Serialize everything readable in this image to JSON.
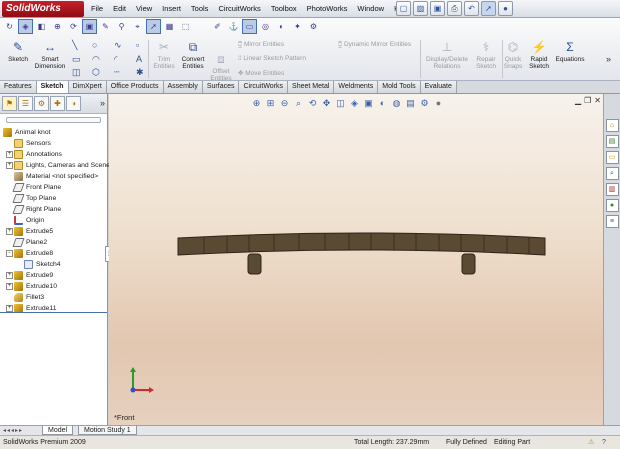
{
  "app": {
    "logo_text": "SolidWorks"
  },
  "menu": [
    "File",
    "Edit",
    "View",
    "Insert",
    "Tools",
    "CircuitWorks",
    "Toolbox",
    "PhotoWorks",
    "Window",
    "Help"
  ],
  "title_tools": [
    "new-doc-icon",
    "open-icon",
    "save-icon",
    "print-icon",
    "undo-icon",
    "select-icon",
    "rebuild-icon"
  ],
  "commands": {
    "sketch": "Sketch",
    "smart_dimension": "Smart\nDimension",
    "trim_entities": "Trim\nEntities",
    "convert_entities": "Convert\nEntities",
    "offset_entities": "Offset\nEntities",
    "mirror_entities": "Mirror Entities",
    "linear_pattern": "Linear Sketch Pattern",
    "move_entities": "Move Entities",
    "dynamic_mirror": "Dynamic Mirror Entities",
    "display_delete": "Display/Delete\nRelations",
    "repair_sketch": "Repair\nSketch",
    "quick_snaps": "Quick\nSnaps",
    "rapid_sketch": "Rapid\nSketch",
    "equations": "Equations"
  },
  "tabs": [
    "Features",
    "Sketch",
    "DimXpert",
    "Office Products",
    "Assembly",
    "Surfaces",
    "CircuitWorks",
    "Sheet Metal",
    "Weldments",
    "Mold Tools",
    "Evaluate"
  ],
  "active_tab": "Sketch",
  "tree": {
    "root": "Animal knot",
    "items": [
      {
        "label": "Sensors",
        "icon": "folder",
        "expander": ""
      },
      {
        "label": "Annotations",
        "icon": "folder",
        "expander": "+"
      },
      {
        "label": "Lights, Cameras and Scene",
        "icon": "folder",
        "expander": "+"
      },
      {
        "label": "Material <not specified>",
        "icon": "mat",
        "expander": ""
      },
      {
        "label": "Front Plane",
        "icon": "plane",
        "expander": ""
      },
      {
        "label": "Top Plane",
        "icon": "plane",
        "expander": ""
      },
      {
        "label": "Right Plane",
        "icon": "plane",
        "expander": ""
      },
      {
        "label": "Origin",
        "icon": "origin",
        "expander": ""
      },
      {
        "label": "Extrude5",
        "icon": "feat",
        "expander": "+"
      },
      {
        "label": "Plane2",
        "icon": "plane",
        "expander": ""
      },
      {
        "label": "Extrude8",
        "icon": "feat",
        "expander": "-"
      },
      {
        "label": "Sketch4",
        "icon": "sketch",
        "expander": "",
        "indent": true
      },
      {
        "label": "Extrude9",
        "icon": "feat",
        "expander": "+"
      },
      {
        "label": "Extrude10",
        "icon": "feat",
        "expander": "+"
      },
      {
        "label": "Fillet3",
        "icon": "fillet",
        "expander": ""
      },
      {
        "label": "Extrude11",
        "icon": "feat",
        "expander": "+"
      }
    ]
  },
  "graphics": {
    "view_name": "*Front",
    "part_color": "#5b4a33",
    "part_edge": "#2e2418"
  },
  "bottom_tabs": [
    "Model",
    "Motion Study 1"
  ],
  "status": {
    "product": "SolidWorks Premium 2009",
    "total_length": "Total Length: 237.29mm",
    "state": "Fully Defined",
    "mode": "Editing Part"
  }
}
